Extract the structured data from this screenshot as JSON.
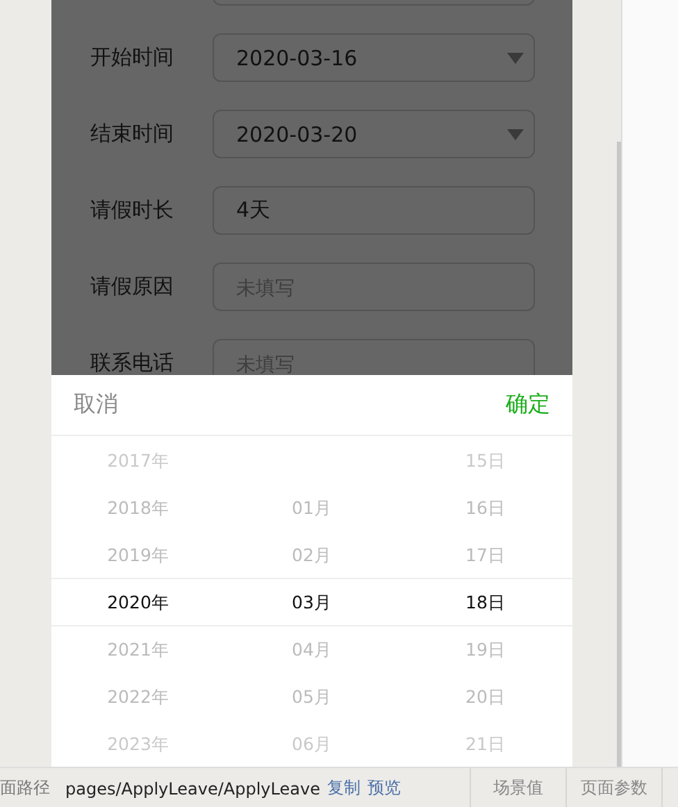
{
  "form": [
    {
      "kind": "input"
    },
    {
      "label": "开始时间",
      "kind": "select",
      "value": "2020-03-16"
    },
    {
      "label": "结束时间",
      "kind": "select",
      "value": "2020-03-20"
    },
    {
      "label": "请假时长",
      "kind": "input",
      "value": "4天"
    },
    {
      "label": "请假原因",
      "kind": "input",
      "placeholder": "未填写"
    },
    {
      "label": "联系电话",
      "kind": "input",
      "placeholder": "未填写"
    }
  ],
  "picker": {
    "cancel": "取消",
    "confirm": "确定",
    "columns": [
      {
        "items": [
          {
            "text": "2017年",
            "selected": false
          },
          {
            "text": "2018年",
            "selected": false
          },
          {
            "text": "2019年",
            "selected": false
          },
          {
            "text": "2020年",
            "selected": true
          },
          {
            "text": "2021年",
            "selected": false
          },
          {
            "text": "2022年",
            "selected": false
          },
          {
            "text": "2023年",
            "selected": false
          }
        ]
      },
      {
        "items": [
          {
            "text": "01月",
            "selected": false
          },
          {
            "text": "02月",
            "selected": false
          },
          {
            "text": "03月",
            "selected": true
          },
          {
            "text": "04月",
            "selected": false
          },
          {
            "text": "05月",
            "selected": false
          },
          {
            "text": "06月",
            "selected": false
          }
        ]
      },
      {
        "items": [
          {
            "text": "15日",
            "selected": false
          },
          {
            "text": "16日",
            "selected": false
          },
          {
            "text": "17日",
            "selected": false
          },
          {
            "text": "18日",
            "selected": true
          },
          {
            "text": "19日",
            "selected": false
          },
          {
            "text": "20日",
            "selected": false
          },
          {
            "text": "21日",
            "selected": false
          }
        ]
      }
    ]
  },
  "status_bar": {
    "label": "面路径",
    "path": "pages/ApplyLeave/ApplyLeave",
    "links": [
      "复制",
      "预览"
    ],
    "tabs": [
      "场景值",
      "页面参数"
    ]
  }
}
